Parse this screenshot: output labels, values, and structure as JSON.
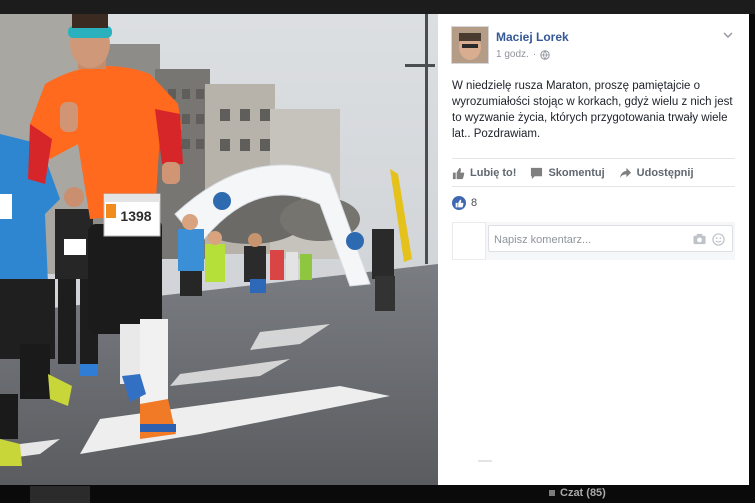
{
  "post": {
    "author": "Maciej Lorek",
    "time": "1 godz.",
    "text": "W niedzielę rusza Maraton, proszę pamiętajcie o wyrozumiałości stojąc w korkach, gdyż wielu z nich jest to wyzwanie życia, których przygotowania trwały wiele lat.. Pozdrawiam."
  },
  "photo": {
    "bib_number": "1398"
  },
  "actions": {
    "like": "Lubię to!",
    "comment": "Skomentuj",
    "share": "Udostępnij"
  },
  "likes": {
    "count": "8"
  },
  "comment_input": {
    "placeholder": "Napisz komentarz..."
  },
  "background": {
    "chat_label": "Czat (85)"
  },
  "colors": {
    "link": "#365899",
    "like_blue": "#4267b2",
    "shirt_orange": "#ff6a1f"
  }
}
